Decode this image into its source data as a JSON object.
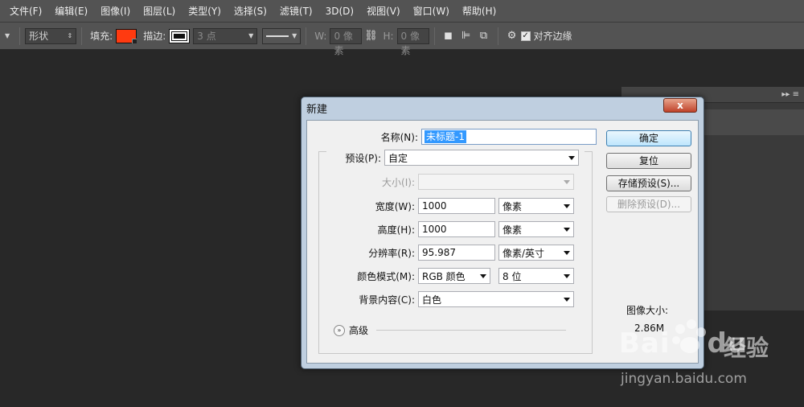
{
  "menubar": {
    "items": [
      "文件(F)",
      "编辑(E)",
      "图像(I)",
      "图层(L)",
      "类型(Y)",
      "选择(S)",
      "滤镜(T)",
      "3D(D)",
      "视图(V)",
      "窗口(W)",
      "帮助(H)"
    ]
  },
  "options": {
    "mode": "形状",
    "fill_label": "填充:",
    "fill_color": "#ff3a10",
    "stroke_label": "描边:",
    "stroke_size": "3 点",
    "w_label": "W:",
    "w_value": "0 像素",
    "h_label": "H:",
    "h_value": "0 像素",
    "align_edges_label": "对齐边缘",
    "align_edges_checked": true
  },
  "dialog": {
    "title": "新建",
    "close_label": "x",
    "name_label": "名称(N):",
    "name_value": "未标题-1",
    "preset_label": "预设(P):",
    "preset_value": "自定",
    "size_label": "大小(I):",
    "size_value": "",
    "width_label": "宽度(W):",
    "width_value": "1000",
    "width_unit": "像素",
    "height_label": "高度(H):",
    "height_value": "1000",
    "height_unit": "像素",
    "resolution_label": "分辨率(R):",
    "resolution_value": "95.987",
    "resolution_unit": "像素/英寸",
    "color_mode_label": "颜色模式(M):",
    "color_mode_value": "RGB 颜色",
    "bit_depth_value": "8 位",
    "background_label": "背景内容(C):",
    "background_value": "白色",
    "advanced_label": "高级",
    "buttons": {
      "ok": "确定",
      "reset": "复位",
      "save_preset": "存储预设(S)...",
      "delete_preset": "删除预设(D)..."
    },
    "image_size_label": "图像大小:",
    "image_size_value": "2.86M"
  },
  "watermark": {
    "logo": "Bai",
    "logo_du": "du",
    "cn": "经验",
    "url": "jingyan.baidu.com"
  }
}
